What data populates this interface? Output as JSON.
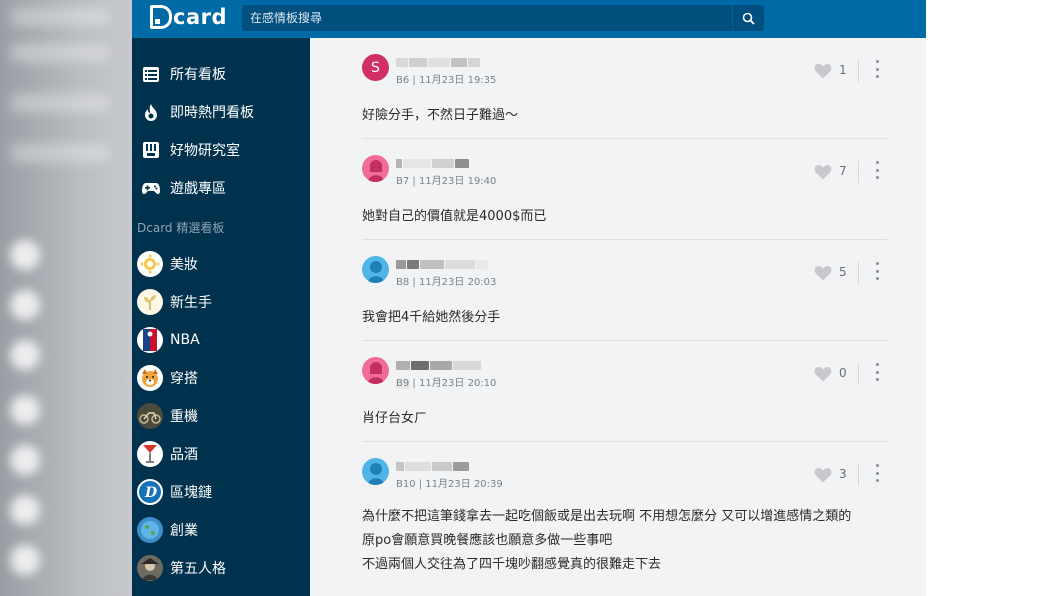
{
  "header": {
    "logo_text": "card",
    "search_placeholder": "在感情板搜尋"
  },
  "sidebar": {
    "nav": [
      {
        "label": "所有看板",
        "icon": "list-icon"
      },
      {
        "label": "即時熱門看板",
        "icon": "fire-icon"
      },
      {
        "label": "好物研究室",
        "icon": "store-icon"
      },
      {
        "label": "遊戲專區",
        "icon": "gamepad-icon"
      }
    ],
    "section_label": "Dcard 精選看板",
    "boards": [
      {
        "label": "美妝",
        "icon": "makeup-icon"
      },
      {
        "label": "新生手",
        "icon": "sprout-icon"
      },
      {
        "label": "NBA",
        "icon": "nba-logo-icon"
      },
      {
        "label": "穿搭",
        "icon": "dog-icon"
      },
      {
        "label": "重機",
        "icon": "motorcycle-icon"
      },
      {
        "label": "品酒",
        "icon": "wine-glass-icon"
      },
      {
        "label": "區塊鏈",
        "icon": "bitcoin-icon"
      },
      {
        "label": "創業",
        "icon": "globe-icon"
      },
      {
        "label": "第五人格",
        "icon": "character-icon"
      }
    ]
  },
  "comments": [
    {
      "avatar_letter": "S",
      "avatar_color": "#d02f68",
      "meta": "B6 | 11月23日 19:35",
      "lines": [
        "好險分手，不然日子難過～"
      ],
      "likes": "1"
    },
    {
      "avatar_letter": "",
      "avatar_color": "#f16c9a",
      "meta": "B7 | 11月23日 19:40",
      "lines": [
        "她對自己的價值就是4000$而已"
      ],
      "likes": "7"
    },
    {
      "avatar_letter": "",
      "avatar_color": "#4fb5e8",
      "meta": "B8 | 11月23日 20:03",
      "lines": [
        "我會把4千給她然後分手"
      ],
      "likes": "5"
    },
    {
      "avatar_letter": "",
      "avatar_color": "#f16c9a",
      "meta": "B9 | 11月23日 20:10",
      "lines": [
        "肖仔台女ㄏ"
      ],
      "likes": "0"
    },
    {
      "avatar_letter": "",
      "avatar_color": "#4fb5e8",
      "meta": "B10 | 11月23日 20:39",
      "lines": [
        "為什麼不把這筆錢拿去一起吃個飯或是出去玩啊 不用想怎麼分 又可以增進感情之類的",
        "原po會願意買晚餐應該也願意多做一些事吧",
        "不過兩個人交往為了四千塊吵翻感覺真的很難走下去"
      ],
      "likes": "3"
    }
  ],
  "colors": {
    "header": "#006aa6",
    "sidebar": "#00324e",
    "content_bg": "#f2f3f4"
  }
}
